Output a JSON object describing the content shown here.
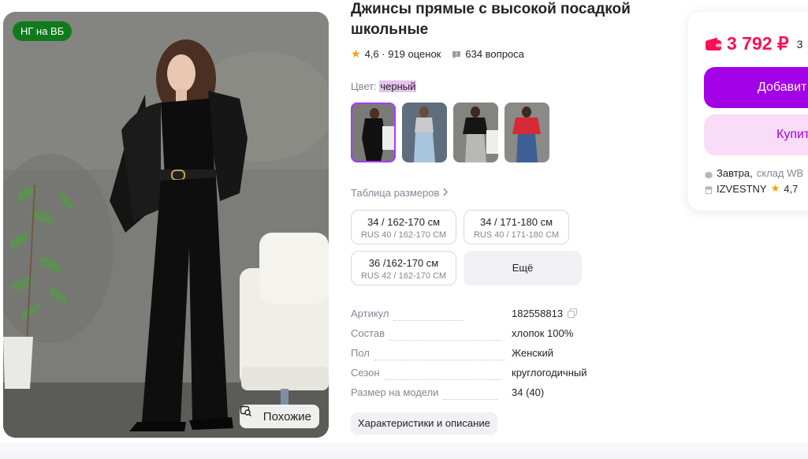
{
  "photo": {
    "badge": "НГ на ВБ",
    "similar_label": "Похожие"
  },
  "product": {
    "title": "Джинсы прямые с высокой посадкой школьные",
    "rating": "4,6",
    "reviews": "919 оценок",
    "questions": "634 вопроса"
  },
  "color": {
    "label": "Цвет:",
    "value": "черный",
    "options": [
      "black",
      "light-blue",
      "grey",
      "blue"
    ]
  },
  "sizes": {
    "table_link": "Таблица размеров",
    "items": [
      {
        "main": "34 / 162-170 см",
        "sub": "RUS 40 / 162-170 СМ"
      },
      {
        "main": "34 / 171-180 см",
        "sub": "RUS 40 / 171-180 СМ"
      },
      {
        "main": "36 /162-170 см",
        "sub": "RUS 42 / 162-170 СМ"
      }
    ],
    "more": "Ещё"
  },
  "params": [
    {
      "key": "Артикул",
      "value": "182558813"
    },
    {
      "key": "Состав",
      "value": "хлопок 100%"
    },
    {
      "key": "Пол",
      "value": "Женский"
    },
    {
      "key": "Сезон",
      "value": "круглогодичный"
    },
    {
      "key": "Размер на модели",
      "value": "34 (40)"
    }
  ],
  "chars_button": "Характеристики и описание",
  "price_card": {
    "price": "3 792 ₽",
    "old_price": "3",
    "add_label": "Добавит",
    "buy_label": "Купит",
    "delivery_day": "Завтра,",
    "delivery_from": "склад WB",
    "seller": "IZVESTNY",
    "seller_rating": "4,7"
  },
  "colors": {
    "accent": "#a200e6",
    "price": "#f91155",
    "badge": "#0f7b1d"
  }
}
